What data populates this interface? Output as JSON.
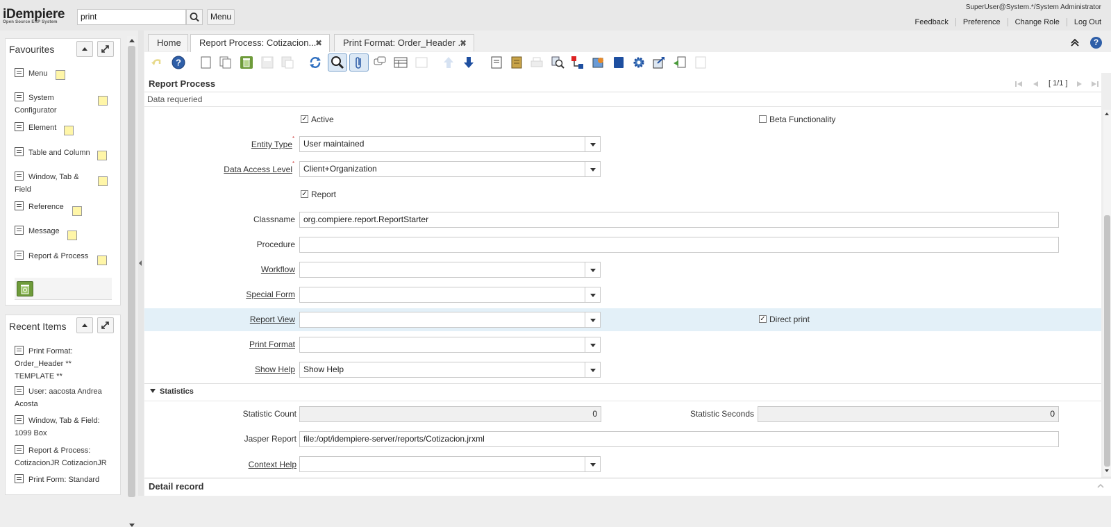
{
  "header": {
    "logo": "iDempiere",
    "logo_sub": "Open Source ERP System",
    "search_value": "print",
    "menu_label": "Menu",
    "user_info": "SuperUser@System.*/System Administrator",
    "links": [
      "Feedback",
      "Preference",
      "Change Role",
      "Log Out"
    ]
  },
  "favourites": {
    "title": "Favourites",
    "items": [
      "Menu",
      "System Configurator",
      "Element",
      "Table and Column",
      "Window, Tab & Field",
      "Reference",
      "Message",
      "Report & Process"
    ]
  },
  "recent": {
    "title": "Recent Items",
    "items": [
      "Print Format: Order_Header ** TEMPLATE **",
      "User: aacosta Andrea Acosta",
      "Window, Tab & Field: 1099 Box",
      "Report & Process: CotizacionJR CotizacionJR",
      "Print Form: Standard"
    ]
  },
  "tabs": [
    {
      "label": "Home"
    },
    {
      "label": "Report Process: Cotizacion..."
    },
    {
      "label": "Print Format: Order_Header ..."
    }
  ],
  "window": {
    "title": "Report Process",
    "record_nav": "[ 1/1 ]",
    "status": "Data requeried",
    "section_statistics": "Statistics",
    "detail_record": "Detail record"
  },
  "form": {
    "active_label": "Active",
    "beta_label": "Beta Functionality",
    "entity_type_label": "Entity Type",
    "entity_type_value": "User maintained",
    "data_access_label": "Data Access Level",
    "data_access_value": "Client+Organization",
    "report_label": "Report",
    "classname_label": "Classname",
    "classname_value": "org.compiere.report.ReportStarter",
    "procedure_label": "Procedure",
    "workflow_label": "Workflow",
    "special_form_label": "Special Form",
    "report_view_label": "Report View",
    "direct_print_label": "Direct print",
    "print_format_label": "Print Format",
    "show_help_label": "Show Help",
    "show_help_value": "Show Help",
    "stat_count_label": "Statistic Count",
    "stat_count_value": "0",
    "stat_seconds_label": "Statistic Seconds",
    "stat_seconds_value": "0",
    "jasper_label": "Jasper Report",
    "jasper_value": "file:/opt/idempiere-server/reports/Cotizacion.jrxml",
    "context_help_label": "Context Help"
  },
  "colors": {
    "highlight_row": "#e3f0f8",
    "accent_blue": "#2255aa"
  }
}
